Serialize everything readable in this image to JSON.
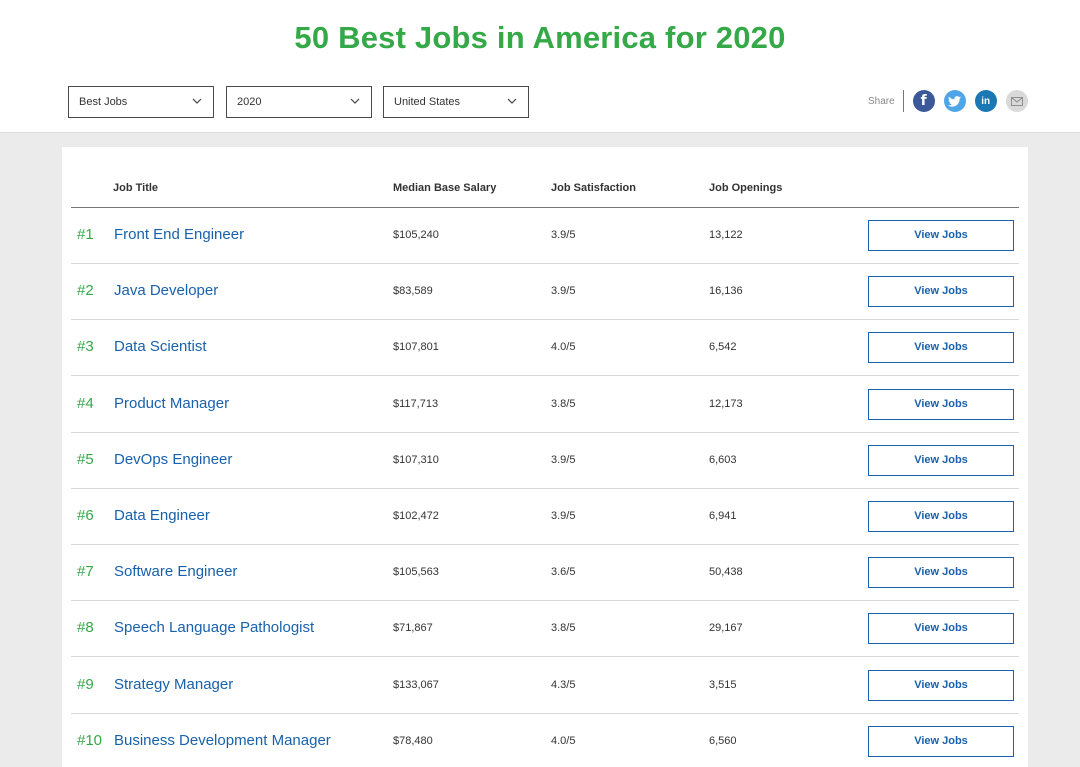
{
  "page": {
    "title": "50 Best Jobs in America for 2020",
    "title_color": "#35a947",
    "rank_color": "#35a947",
    "link_color": "#1861ac"
  },
  "filters": [
    {
      "name": "list-type-dropdown",
      "value": "Best Jobs"
    },
    {
      "name": "year-dropdown",
      "value": "2020"
    },
    {
      "name": "country-dropdown",
      "value": "United States"
    }
  ],
  "share": {
    "label": "Share",
    "icons": [
      {
        "name": "facebook-icon",
        "glyph": "f",
        "color": "#3b5998"
      },
      {
        "name": "twitter-icon",
        "glyph": "",
        "color": "#4ea6e9"
      },
      {
        "name": "linkedin-icon",
        "glyph": "in",
        "color": "#1a78b4"
      },
      {
        "name": "email-icon",
        "glyph": "",
        "color": "#d9d9d9"
      }
    ]
  },
  "table": {
    "headers": [
      "Job Title",
      "Median Base Salary",
      "Job Satisfaction",
      "Job Openings"
    ],
    "button_label": "View Jobs",
    "rows": [
      {
        "rank": "#1",
        "title": "Front End Engineer",
        "salary": "$105,240",
        "satisfaction": "3.9/5",
        "openings": "13,122"
      },
      {
        "rank": "#2",
        "title": "Java Developer",
        "salary": "$83,589",
        "satisfaction": "3.9/5",
        "openings": "16,136"
      },
      {
        "rank": "#3",
        "title": "Data Scientist",
        "salary": "$107,801",
        "satisfaction": "4.0/5",
        "openings": "6,542"
      },
      {
        "rank": "#4",
        "title": "Product Manager",
        "salary": "$117,713",
        "satisfaction": "3.8/5",
        "openings": "12,173"
      },
      {
        "rank": "#5",
        "title": "DevOps Engineer",
        "salary": "$107,310",
        "satisfaction": "3.9/5",
        "openings": "6,603"
      },
      {
        "rank": "#6",
        "title": "Data Engineer",
        "salary": "$102,472",
        "satisfaction": "3.9/5",
        "openings": "6,941"
      },
      {
        "rank": "#7",
        "title": "Software Engineer",
        "salary": "$105,563",
        "satisfaction": "3.6/5",
        "openings": "50,438"
      },
      {
        "rank": "#8",
        "title": "Speech Language Pathologist",
        "salary": "$71,867",
        "satisfaction": "3.8/5",
        "openings": "29,167"
      },
      {
        "rank": "#9",
        "title": "Strategy Manager",
        "salary": "$133,067",
        "satisfaction": "4.3/5",
        "openings": "3,515"
      },
      {
        "rank": "#10",
        "title": "Business Development Manager",
        "salary": "$78,480",
        "satisfaction": "4.0/5",
        "openings": "6,560"
      }
    ]
  }
}
